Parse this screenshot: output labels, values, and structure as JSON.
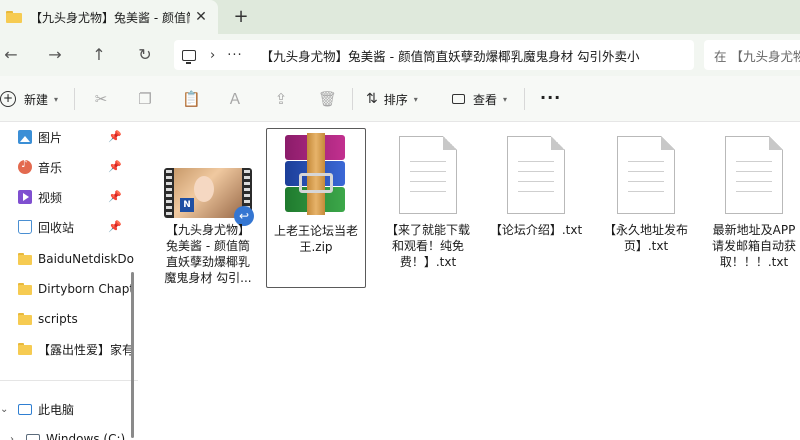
{
  "tab": {
    "title": "【九头身尤物】兔美酱 - 颜值筒",
    "close_glyph": "✕",
    "new_glyph": "+"
  },
  "address": {
    "path": "【九头身尤物】兔美酱 - 颜值筒直妖孽劲爆椰乳魔鬼身材 勾引外卖小",
    "more": "···",
    "sep": "›",
    "search_placeholder": "在 【九头身尤物"
  },
  "toolbar": {
    "new_label": "新建",
    "sort_label": "排序",
    "view_label": "查看",
    "more_label": "···"
  },
  "sidebar": {
    "items": [
      {
        "label": "图片",
        "icon": "pictures-icon",
        "pinned": true
      },
      {
        "label": "音乐",
        "icon": "music-icon",
        "pinned": true
      },
      {
        "label": "视频",
        "icon": "videos-icon",
        "pinned": true
      },
      {
        "label": "回收站",
        "icon": "recycle-bin-icon",
        "pinned": true
      },
      {
        "label": "BaiduNetdiskDo",
        "icon": "folder-icon",
        "pinned": false
      },
      {
        "label": "Dirtyborn Chapt",
        "icon": "folder-icon",
        "pinned": false
      },
      {
        "label": "scripts",
        "icon": "folder-icon",
        "pinned": false
      },
      {
        "label": "【露出性爱】家有",
        "icon": "folder-icon",
        "pinned": false
      }
    ],
    "this_pc": "此电脑",
    "drive": "Windows (C:)"
  },
  "files": [
    {
      "name": "【九头身尤物】兔美酱 - 颜值筒直妖孽劲爆椰乳魔鬼身材 勾引...",
      "type": "video"
    },
    {
      "name": "上老王论坛当老王.zip",
      "type": "zip"
    },
    {
      "name": "【来了就能下载和观看！纯免费！】.txt",
      "type": "txt"
    },
    {
      "name": "【论坛介绍】.txt",
      "type": "txt"
    },
    {
      "name": "【永久地址发布页】.txt",
      "type": "txt"
    },
    {
      "name": "最新地址及APP请发邮箱自动获取！！！.txt",
      "type": "txt"
    }
  ],
  "colors": {
    "tabbar_bg": "#dfe9dc",
    "folder": "#f6cb52",
    "accent": "#3476d2"
  }
}
